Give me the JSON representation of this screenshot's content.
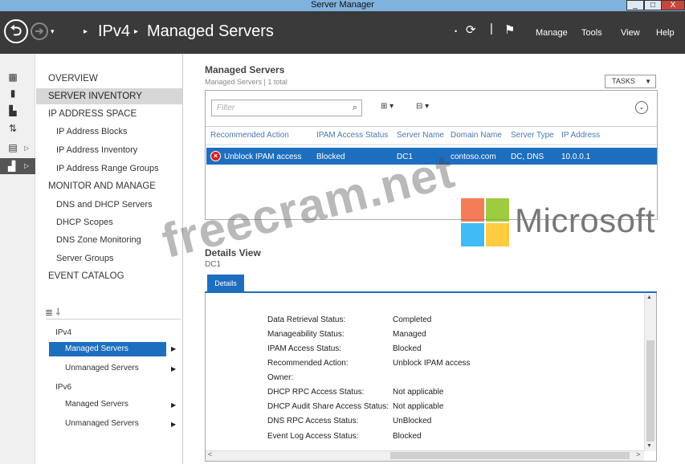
{
  "window": {
    "title": "Server Manager",
    "min_label": "_",
    "max_label": "□",
    "close_label": "X"
  },
  "header": {
    "back_glyph": "⮌",
    "forward_glyph": "➔",
    "dropdown_glyph": "▾",
    "breadcrumb": [
      "IPv4",
      "Managed Servers"
    ],
    "sep_glyph": "▸",
    "refresh_glyph": "⟳",
    "flag_glyph": "⚑",
    "menu": [
      "Manage",
      "Tools",
      "View",
      "Help"
    ]
  },
  "rail": {
    "icons": [
      "dashboard-icon",
      "local-server-icon",
      "all-servers-icon",
      "file-services-icon",
      "roles-icon",
      "ipam-icon"
    ],
    "glyphs": [
      "▦",
      "▮",
      "▙",
      "⇅",
      "▤",
      "▟"
    ],
    "arrow": "▷"
  },
  "nav": {
    "items": [
      {
        "label": "OVERVIEW",
        "kind": "hdr"
      },
      {
        "label": "SERVER INVENTORY",
        "kind": "hdr",
        "selected": true
      },
      {
        "label": "IP ADDRESS SPACE",
        "kind": "hdr"
      },
      {
        "label": "IP Address Blocks",
        "kind": "sub"
      },
      {
        "label": "IP Address Inventory",
        "kind": "sub"
      },
      {
        "label": "IP Address Range Groups",
        "kind": "sub"
      },
      {
        "label": "MONITOR AND MANAGE",
        "kind": "hdr"
      },
      {
        "label": "DNS and DHCP Servers",
        "kind": "sub"
      },
      {
        "label": "DHCP Scopes",
        "kind": "sub"
      },
      {
        "label": "DNS Zone Monitoring",
        "kind": "sub"
      },
      {
        "label": "Server Groups",
        "kind": "sub"
      },
      {
        "label": "EVENT CATALOG",
        "kind": "hdr"
      }
    ],
    "tree_icons": "≣  ⸸",
    "tree": {
      "ipv4": "IPv4",
      "ipv4_managed": "Managed Servers",
      "ipv4_unmanaged": "Unmanaged Servers",
      "ipv6": "IPv6",
      "ipv6_managed": "Managed Servers",
      "ipv6_unmanaged": "Unmanaged Servers",
      "arrow": "▶"
    }
  },
  "main": {
    "title": "Managed Servers",
    "subtitle": "Managed Servers | 1 total",
    "tasks_label": "TASKS",
    "tasks_arrow": "▼",
    "filter_placeholder": "Filter",
    "search_glyph": "⌕",
    "ctrl1": "⊞ ▾",
    "ctrl2": "⊟ ▾",
    "expand_glyph": "⌄",
    "columns": [
      "Recommended Action",
      "IPAM Access Status",
      "Server Name",
      "Domain Name",
      "Server Type",
      "IP Address"
    ],
    "row": {
      "error_glyph": "×",
      "cells": [
        "Unblock IPAM access",
        "Blocked",
        "DC1",
        "contoso.com",
        "DC, DNS",
        "10.0.0.1"
      ]
    }
  },
  "details": {
    "title": "Details View",
    "subtitle": "DC1",
    "tab": "Details",
    "fields": [
      {
        "label": "Data Retrieval Status:",
        "value": "Completed"
      },
      {
        "label": "Manageability Status:",
        "value": "Managed"
      },
      {
        "label": "IPAM Access Status:",
        "value": "Blocked"
      },
      {
        "label": "Recommended Action:",
        "value": "Unblock IPAM access"
      },
      {
        "label": "Owner:",
        "value": ""
      },
      {
        "label": "DHCP RPC Access Status:",
        "value": "Not applicable"
      },
      {
        "label": "DHCP Audit Share Access Status:",
        "value": "Not applicable"
      },
      {
        "label": "DNS RPC Access Status:",
        "value": "UnBlocked"
      },
      {
        "label": "Event Log Access Status:",
        "value": "Blocked"
      }
    ],
    "scroll_up": "▲",
    "scroll_down": "▼",
    "scroll_left": "<",
    "scroll_right": ">"
  },
  "overlay": {
    "watermark": "freecram.net",
    "ms_text": "Microsoft",
    "ms_colors": [
      "#f25022",
      "#7fba00",
      "#00a4ef",
      "#ffb900"
    ]
  }
}
